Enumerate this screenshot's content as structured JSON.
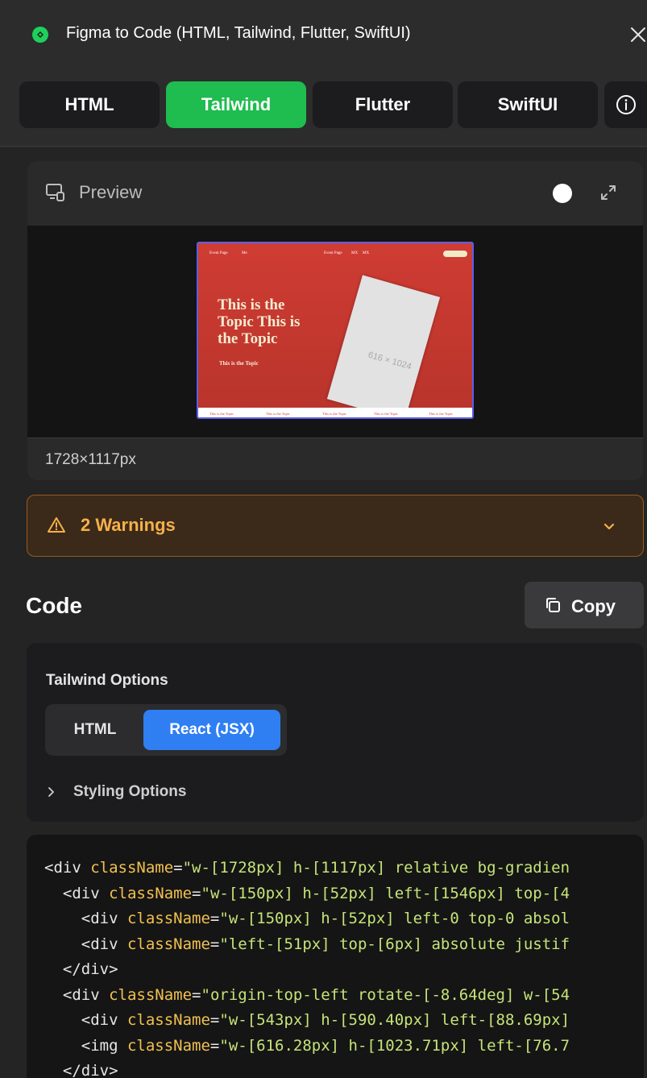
{
  "window": {
    "title": "Figma to Code (HTML, Tailwind, Flutter, SwiftUI)"
  },
  "tabs": [
    {
      "label": "HTML",
      "active": false
    },
    {
      "label": "Tailwind",
      "active": true
    },
    {
      "label": "Flutter",
      "active": false
    },
    {
      "label": "SwiftUI",
      "active": false
    }
  ],
  "preview": {
    "label": "Preview",
    "dimensions": "1728×1117px",
    "thumbnail": {
      "nav_left_1": "Event Page",
      "nav_left_2": "Me",
      "nav_mid_1": "Event Page",
      "nav_mid_2": "MX",
      "nav_mid_3": "MX",
      "pill": "••••",
      "heading": "This is the Topic This is the Topic",
      "subheading": "This is the Topic",
      "card_label": "616 × 1024",
      "footer_links": [
        "This is the Topic",
        "This is the Topic",
        "This is the Topic",
        "This is the Topic",
        "This is the Topic"
      ]
    }
  },
  "warnings": {
    "label": "2 Warnings"
  },
  "code": {
    "title": "Code",
    "copy_label": "Copy",
    "options_title": "Tailwind Options",
    "mode_html": "HTML",
    "mode_react": "React (JSX)",
    "styling_options": "Styling Options",
    "lines": [
      {
        "indent": "",
        "tag": "<div ",
        "attr": "className",
        "str": "\"w-[1728px] h-[1117px] relative bg-gradien"
      },
      {
        "indent": "  ",
        "tag": "<div ",
        "attr": "className",
        "str": "\"w-[150px] h-[52px] left-[1546px] top-[4"
      },
      {
        "indent": "    ",
        "tag": "<div ",
        "attr": "className",
        "str": "\"w-[150px] h-[52px] left-0 top-0 absol"
      },
      {
        "indent": "    ",
        "tag": "<div ",
        "attr": "className",
        "str": "\"left-[51px] top-[6px] absolute justif"
      },
      {
        "indent": "  ",
        "tag": "</div>",
        "attr": "",
        "str": ""
      },
      {
        "indent": "  ",
        "tag": "<div ",
        "attr": "className",
        "str": "\"origin-top-left rotate-[-8.64deg] w-[54"
      },
      {
        "indent": "    ",
        "tag": "<div ",
        "attr": "className",
        "str": "\"w-[543px] h-[590.40px] left-[88.69px]"
      },
      {
        "indent": "    ",
        "tag": "<img ",
        "attr": "className",
        "str": "\"w-[616.28px] h-[1023.71px] left-[76.7"
      },
      {
        "indent": "  ",
        "tag": "</div>",
        "attr": "",
        "str": ""
      }
    ]
  },
  "colors": {
    "accent_green": "#1fbc4f",
    "accent_blue": "#2f7ff3",
    "warning_orange": "#f5b04a"
  }
}
